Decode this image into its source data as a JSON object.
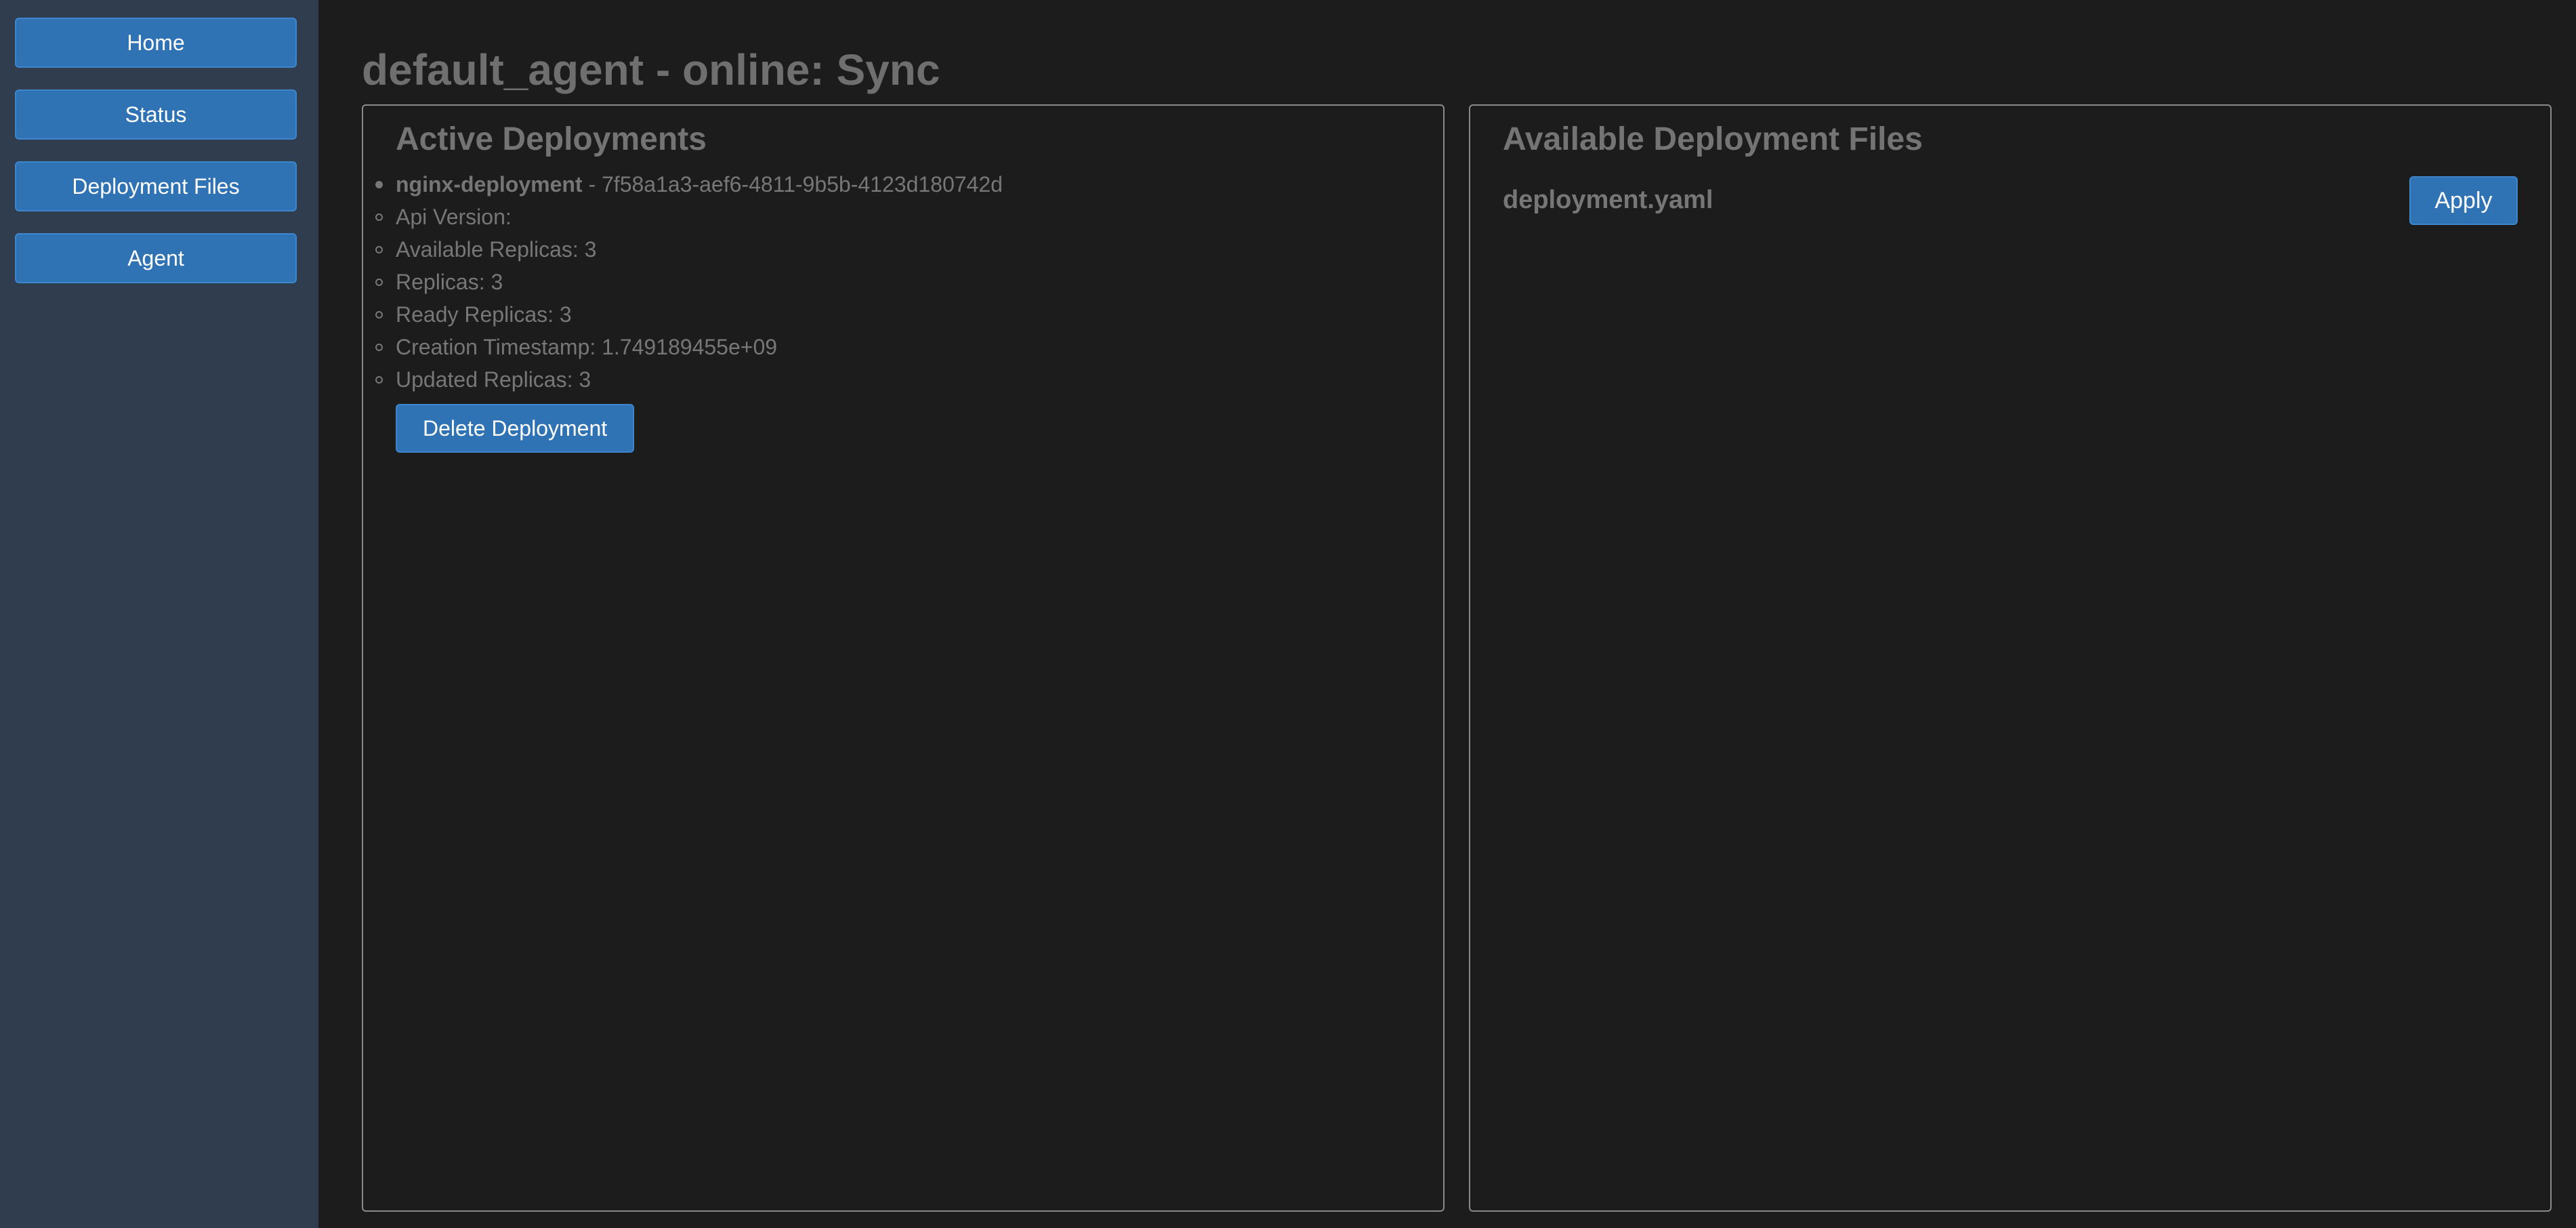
{
  "sidebar": {
    "items": [
      {
        "label": "Home"
      },
      {
        "label": "Status"
      },
      {
        "label": "Deployment Files"
      },
      {
        "label": "Agent"
      }
    ]
  },
  "page": {
    "title": "default_agent - online: Sync"
  },
  "active_deployments": {
    "title": "Active Deployments",
    "deployment": {
      "name": "nginx-deployment",
      "id_text": " - 7f58a1a3-aef6-4811-9b5b-4123d180742d",
      "details": [
        "Api Version:",
        "Available Replicas: 3",
        "Replicas: 3",
        "Ready Replicas: 3",
        "Creation Timestamp: 1.749189455e+09",
        "Updated Replicas: 3"
      ]
    },
    "delete_label": "Delete Deployment"
  },
  "available_files": {
    "title": "Available Deployment Files",
    "files": [
      {
        "name": "deployment.yaml",
        "action_label": "Apply"
      }
    ]
  },
  "colors": {
    "background": "#1c1c1d",
    "sidebar": "#2f3d4e",
    "button": "#2f73b5",
    "text_muted": "#777777",
    "panel_border": "#8a8a8a"
  }
}
